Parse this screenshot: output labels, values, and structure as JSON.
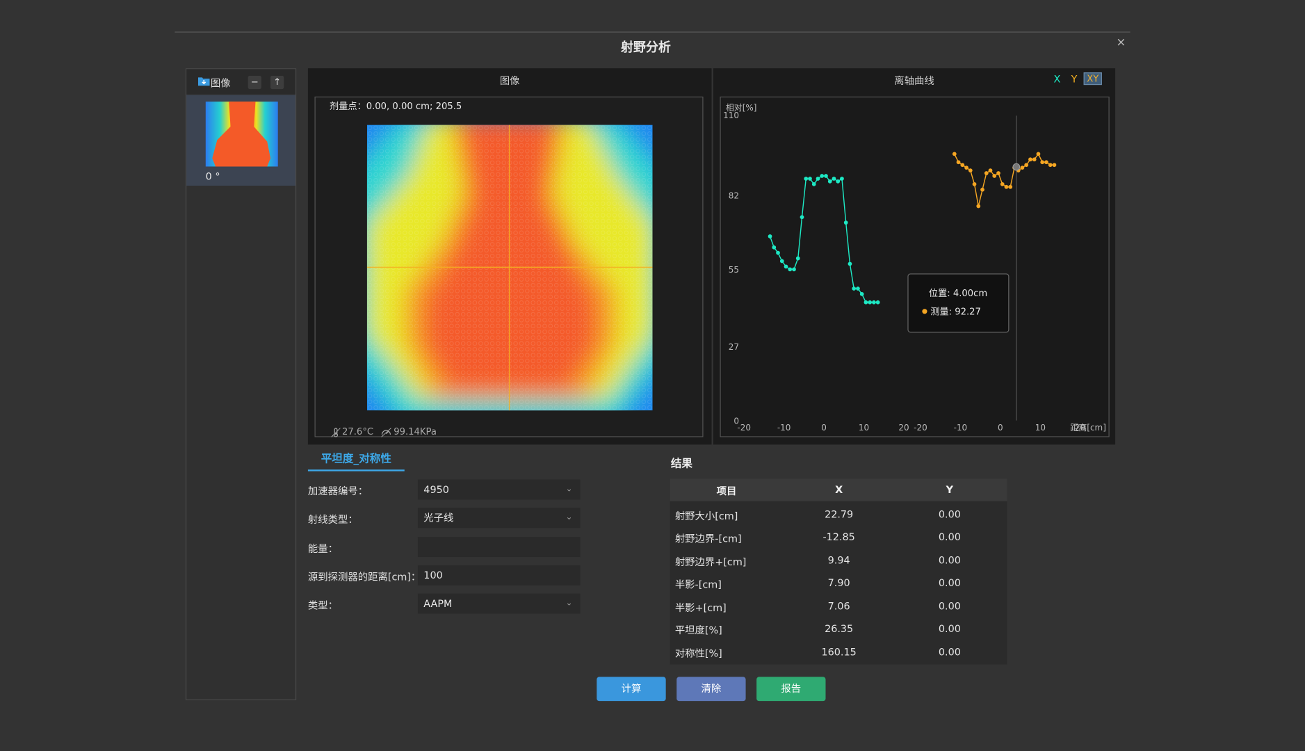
{
  "dialog": {
    "title": "射野分析",
    "close_icon": "×"
  },
  "image_list": {
    "label": "图像",
    "minus": "−",
    "up": "↑",
    "items": [
      {
        "caption": "0 °"
      }
    ]
  },
  "image_panel": {
    "title": "图像",
    "dose_point": "剂量点：0.00, 0.00 cm; 205.5",
    "temperature": "27.6°C",
    "pressure": "99.14KPa"
  },
  "chart_panel": {
    "title": "离轴曲线",
    "axis_x": "X",
    "axis_y": "Y",
    "axis_xy": "XY",
    "colors": {
      "x_series": "#1de9c4",
      "y_series": "#f5a623"
    }
  },
  "chart_data": {
    "type": "line",
    "ylabel": "相对[%]",
    "xlabel": "距离[cm]",
    "ylim": [
      0,
      110
    ],
    "y_ticks": [
      "110",
      "82",
      "55",
      "27",
      "0"
    ],
    "x_ticks": [
      "-20",
      "-10",
      "0",
      "10",
      "20",
      "-20",
      "-10",
      "0",
      "10",
      "20"
    ],
    "x_ticks_left": [
      -20,
      -10,
      0,
      10,
      20
    ],
    "x_ticks_right": [
      -20,
      -10,
      0,
      10,
      20
    ],
    "series": [
      {
        "color": "#1de9c4",
        "x": [
          -13.5,
          -12.5,
          -11.5,
          -10.5,
          -9.5,
          -8.5,
          -7.5,
          -6.5,
          -5.5,
          -4.5,
          -3.5,
          -2.5,
          -1.5,
          -0.5,
          0.5,
          1.5,
          2.5,
          3.5,
          4.5,
          5.5,
          6.5,
          7.5,
          8.5,
          9.5,
          10.5,
          11.5,
          12.5,
          13.5
        ],
        "y": [
          67,
          63,
          61,
          58,
          56,
          55,
          55,
          59,
          74,
          88,
          88,
          86,
          88,
          89,
          89,
          87,
          88,
          87,
          88,
          72,
          57,
          48,
          48,
          46,
          43,
          43,
          43,
          43
        ]
      },
      {
        "color": "#f5a623",
        "x": [
          -11.5,
          -10.5,
          -9.5,
          -8.5,
          -7.5,
          -6.5,
          -5.5,
          -4.5,
          -3.5,
          -2.5,
          -1.5,
          -0.5,
          0.5,
          1.5,
          2.5,
          3.5,
          4.5,
          5.5,
          6.5,
          7.5,
          8.5,
          9.5,
          10.5,
          11.5,
          12.5,
          13.5
        ],
        "y": [
          97,
          94,
          93,
          92,
          91,
          86,
          78,
          84,
          90,
          91,
          89,
          90,
          86,
          85,
          85,
          92,
          91,
          92,
          93,
          95,
          95,
          97,
          94,
          94,
          93,
          93
        ]
      }
    ],
    "cursor_position_cm": 4.0,
    "tooltip": {
      "position": "位置: 4.00cm",
      "measure": "测量: 92.27"
    }
  },
  "tab": {
    "label": "平坦度_对称性"
  },
  "form": {
    "accelerator_label": "加速器编号：",
    "accelerator_value": "4950",
    "ray_type_label": "射线类型：",
    "ray_type_value": "光子线",
    "energy_label": "能量：",
    "energy_value": "",
    "sdd_label": "源到探测器的距离[cm]：",
    "sdd_value": "100",
    "type_label": "类型：",
    "type_value": "AAPM"
  },
  "results": {
    "title": "结果",
    "headers": [
      "项目",
      "X",
      "Y"
    ],
    "rows": [
      [
        "射野大小[cm]",
        "22.79",
        "0.00"
      ],
      [
        "射野边界-[cm]",
        "-12.85",
        "0.00"
      ],
      [
        "射野边界+[cm]",
        "9.94",
        "0.00"
      ],
      [
        "半影-[cm]",
        "7.90",
        "0.00"
      ],
      [
        "半影+[cm]",
        "7.06",
        "0.00"
      ],
      [
        "平坦度[%]",
        "26.35",
        "0.00"
      ],
      [
        "对称性[%]",
        "160.15",
        "0.00"
      ]
    ]
  },
  "buttons": {
    "calc": "计算",
    "clear": "清除",
    "report": "报告"
  }
}
